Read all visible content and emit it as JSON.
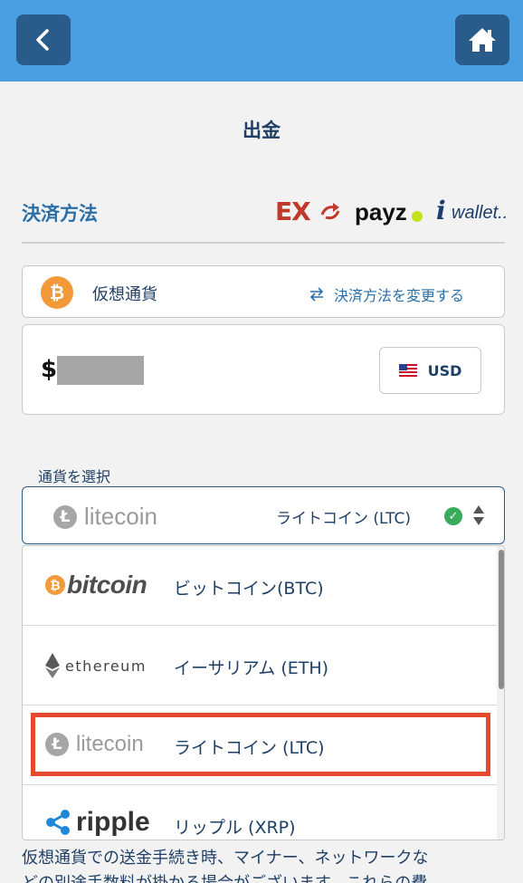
{
  "header": {
    "back_icon": "chevron-left-icon",
    "home_icon": "home-icon",
    "bar_color": "#4a9ee2",
    "button_color": "#2a5c8b"
  },
  "page_title": "出金",
  "payment_section": {
    "label": "決済方法",
    "logos": {
      "ex": "EX",
      "payz": "payz",
      "iwallet_i": "i",
      "iwallet": "wallet.."
    }
  },
  "method": {
    "icon": "bitcoin-icon",
    "name": "仮想通貨",
    "change_icon": "swap-arrows-icon",
    "change_label": "決済方法を変更する"
  },
  "amount": {
    "currency_symbol": "$",
    "value_masked": true,
    "currency_button": "USD",
    "flag_icon": "us-flag-icon"
  },
  "currency_select": {
    "label": "通貨を選択",
    "selected_logo": "litecoin",
    "selected_logo_icon": "Ł",
    "selected_text": "ライトコイン (LTC)",
    "check_icon": "check-circle-icon",
    "arrows_icon": "sort-arrows-icon"
  },
  "dropdown": {
    "highlight_color": "#e64a2e",
    "options": [
      {
        "logo": "bitcoin",
        "logo_icon": "₿",
        "name": "ビットコイン(BTC)"
      },
      {
        "logo": "ethereum",
        "name": "イーサリアム (ETH)"
      },
      {
        "logo": "litecoin",
        "logo_icon": "Ł",
        "name": "ライトコイン (LTC)",
        "highlighted": true
      },
      {
        "logo": "ripple",
        "name": "リップル (XRP)"
      }
    ]
  },
  "notice": {
    "line1": "仮想通貨での送金手続き時、マイナー、ネットワークな",
    "line2": "どの別途手数料が掛かる場合がございます。これらの費"
  }
}
